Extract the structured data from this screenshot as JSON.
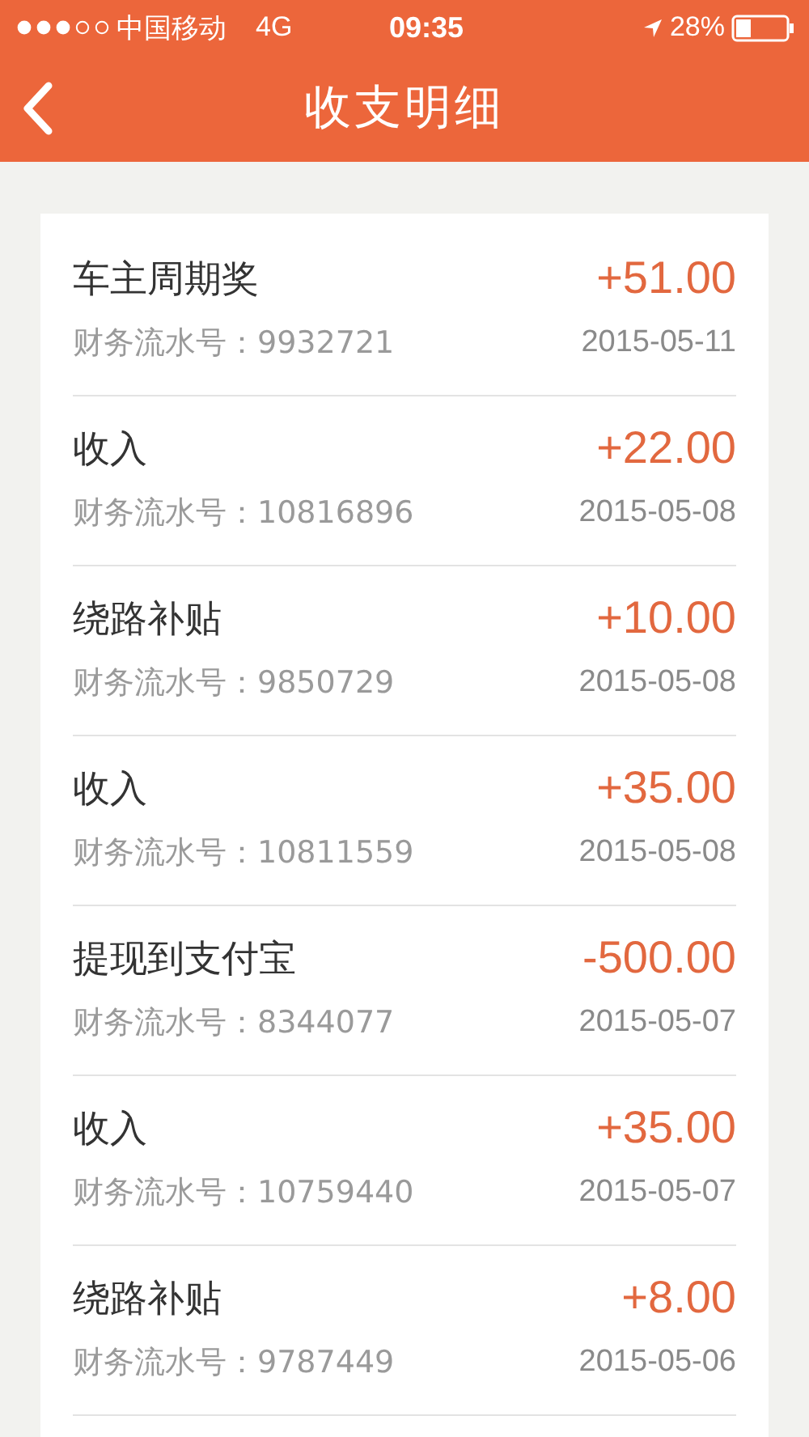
{
  "status_bar": {
    "carrier": "中国移动",
    "network": "4G",
    "time": "09:35",
    "battery": "28%"
  },
  "nav": {
    "title": "收支明细"
  },
  "records": [
    {
      "title": "车主周期奖",
      "amount": "+51.00",
      "serial_label": "财务流水号：",
      "serial": "9932721",
      "date": "2015-05-11"
    },
    {
      "title": "收入",
      "amount": "+22.00",
      "serial_label": "财务流水号：",
      "serial": "10816896",
      "date": "2015-05-08"
    },
    {
      "title": "绕路补贴",
      "amount": "+10.00",
      "serial_label": "财务流水号：",
      "serial": "9850729",
      "date": "2015-05-08"
    },
    {
      "title": "收入",
      "amount": "+35.00",
      "serial_label": "财务流水号：",
      "serial": "10811559",
      "date": "2015-05-08"
    },
    {
      "title": "提现到支付宝",
      "amount": "-500.00",
      "serial_label": "财务流水号：",
      "serial": "8344077",
      "date": "2015-05-07"
    },
    {
      "title": "收入",
      "amount": "+35.00",
      "serial_label": "财务流水号：",
      "serial": "10759440",
      "date": "2015-05-07"
    },
    {
      "title": "绕路补贴",
      "amount": "+8.00",
      "serial_label": "财务流水号：",
      "serial": "9787449",
      "date": "2015-05-06"
    }
  ]
}
